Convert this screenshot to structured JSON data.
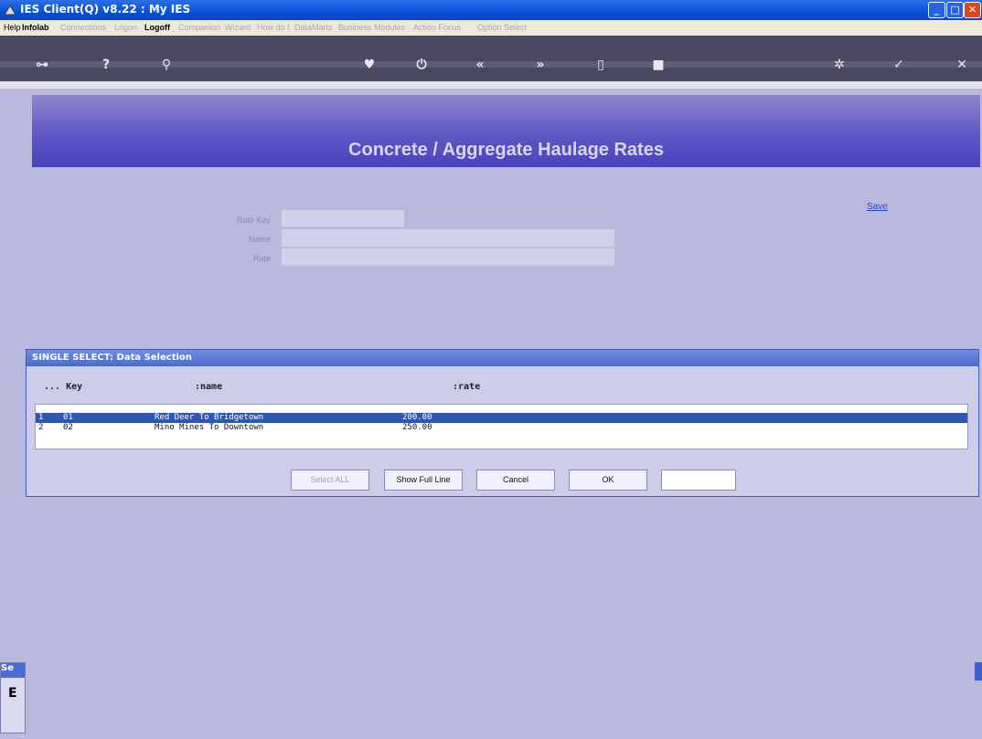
{
  "window": {
    "title": "IES Client(Q) v8.22 : My IES"
  },
  "menu": [
    "Help",
    "Infolab",
    "Connections",
    "Logon",
    "Logoff",
    "Companion",
    "Wizard",
    "How do I",
    "DataMarts",
    "Business Modules",
    "Action Focus",
    "Option Select"
  ],
  "banner": {
    "title": "Concrete / Aggregate Haulage Rates"
  },
  "form": {
    "fields": [
      {
        "label": "Rate Key",
        "value": ""
      },
      {
        "label": "Name",
        "value": ""
      },
      {
        "label": "Rate",
        "value": ""
      }
    ],
    "save_label": "Save"
  },
  "dialog": {
    "title": "SINGLE SELECT: Data Selection",
    "columns": [
      "... Key",
      ":name",
      ":rate"
    ],
    "rows": [
      {
        "idx": "1",
        "key": "01",
        "name": "Red Deer To Bridgetown",
        "rate": "200.00",
        "selected": true
      },
      {
        "idx": "2",
        "key": "02",
        "name": "Mino Mines To Downtown",
        "rate": "250.00",
        "selected": false
      }
    ],
    "buttons": {
      "select_all": "Select ALL",
      "show_full_line": "Show Full Line",
      "cancel": "Cancel",
      "ok": "OK"
    },
    "search_value": ""
  },
  "mini_window": {
    "header": "Se",
    "body": "E"
  },
  "colors": {
    "background": "#b9b8dd",
    "banner": "#5f57c4",
    "selection": "#2e56b3",
    "titlebar": "#0a4fd8"
  }
}
